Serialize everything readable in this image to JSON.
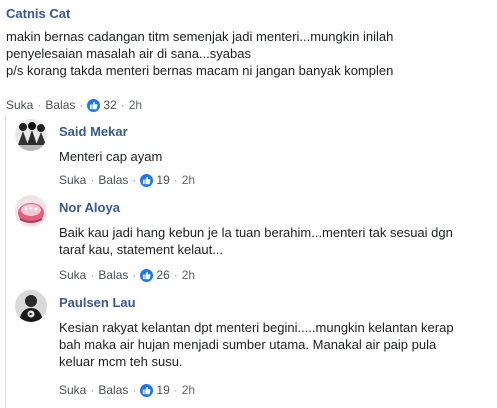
{
  "main_comment": {
    "author": "Catnis Cat",
    "lines": [
      "makin bernas cadangan titm semenjak jadi menteri...mungkin inilah",
      "penyelesaian masalah air di sana...syabas",
      "p/s korang takda menteri bernas macam ni jangan banyak komplen"
    ],
    "like_label": "Suka",
    "reply_label": "Balas",
    "reaction_count": "32",
    "time": "2h"
  },
  "replies": [
    {
      "author": "Said Mekar",
      "lines": [
        "Menteri cap ayam"
      ],
      "like_label": "Suka",
      "reply_label": "Balas",
      "reaction_count": "19",
      "time": "2h"
    },
    {
      "author": "Nor Aloya",
      "lines": [
        "Baik kau jadi hang kebun je la tuan berahim...menteri tak sesuai dgn",
        "taraf kau, statement kelaut..."
      ],
      "like_label": "Suka",
      "reply_label": "Balas",
      "reaction_count": "26",
      "time": "2h"
    },
    {
      "author": "Paulsen Lau",
      "lines": [
        "Kesian rakyat kelantan dpt menteri begini.....mungkin kelantan kerap",
        "bah maka air hujan menjadi sumber utama. Manakal air paip pula",
        "keluar mcm teh susu."
      ],
      "like_label": "Suka",
      "reply_label": "Balas",
      "reaction_count": "19",
      "time": "2h"
    }
  ],
  "colors": {
    "author": "#385898",
    "text": "#1c1e21",
    "meta": "#606770",
    "like_badge": "#1877f2"
  },
  "icons": [
    "thumbs-up-icon",
    "avatar-photo"
  ]
}
